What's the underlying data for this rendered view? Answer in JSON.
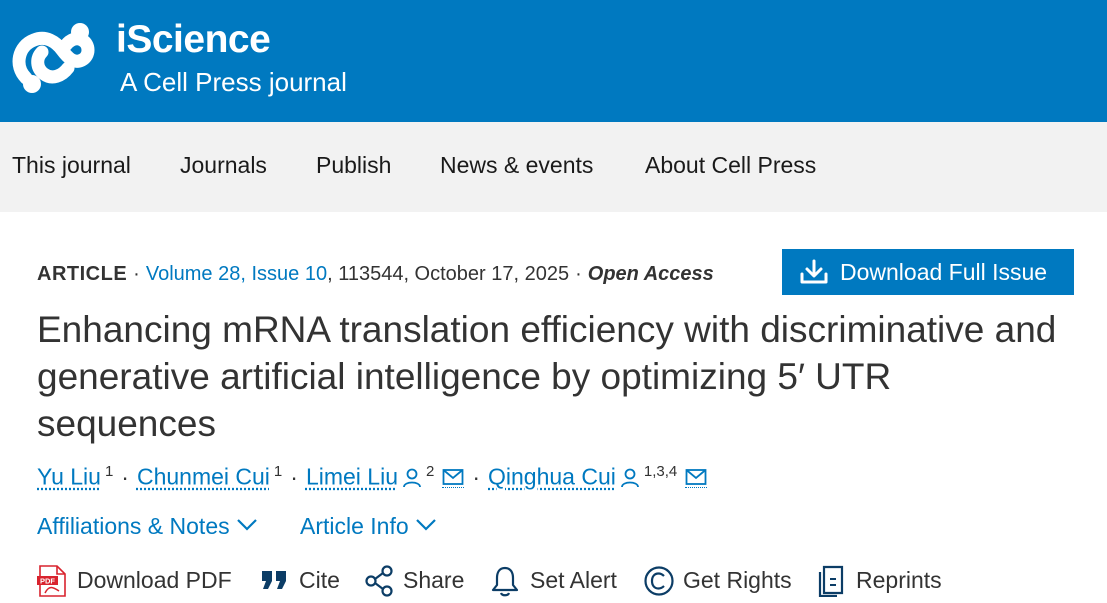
{
  "header": {
    "brand": "iScience",
    "tagline": "A Cell Press journal",
    "bg_color": "#0079c0",
    "logo_icon": "iscience-logo"
  },
  "nav": {
    "items": [
      "This journal",
      "Journals",
      "Publish",
      "News & events",
      "About Cell Press"
    ]
  },
  "article": {
    "type": "ARTICLE",
    "volume": "Volume 28, Issue 10",
    "details": ", 113544, October 17, 2025",
    "access": "Open Access",
    "download_issue_label": "Download Full Issue",
    "download_issue_icon": "download-icon",
    "title": "Enhancing mRNA translation efficiency with discriminative and generative artificial intelligence by optimizing 5′ UTR sequences"
  },
  "authors": [
    {
      "name": "Yu Liu",
      "aff": "1"
    },
    {
      "name": "Chunmei Cui",
      "aff": "1"
    },
    {
      "name": "Limei Liu",
      "aff": "2"
    },
    {
      "name": "Qinghua Cui",
      "aff": "1,3,4"
    }
  ],
  "expanders": {
    "affiliations": "Affiliations & Notes",
    "article_info": "Article Info"
  },
  "actions": {
    "download_pdf": "Download PDF",
    "cite": "Cite",
    "share": "Share",
    "set_alert": "Set Alert",
    "get_rights": "Get Rights",
    "reprints": "Reprints"
  },
  "colors": {
    "accent": "#0079c0",
    "nav_bg": "#f2f2f2",
    "pdf_red": "#d9232e"
  }
}
